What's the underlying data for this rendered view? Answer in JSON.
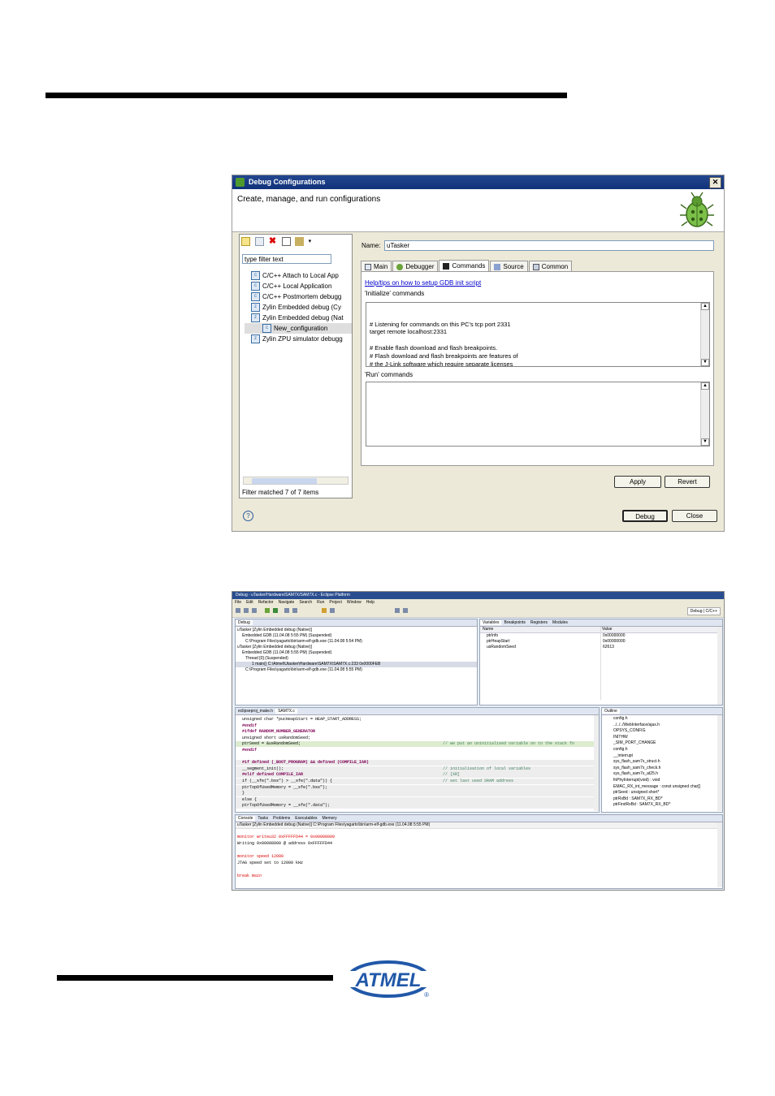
{
  "dialog": {
    "title": "Debug Configurations",
    "header": "Create, manage, and run configurations",
    "filter_placeholder": "type filter text",
    "tree": [
      {
        "label": "C/C++ Attach to Local App",
        "icon": "c-app-icon",
        "indent": 1
      },
      {
        "label": "C/C++ Local Application",
        "icon": "c-app-icon",
        "indent": 1
      },
      {
        "label": "C/C++ Postmortem debugg",
        "icon": "c-app-icon",
        "indent": 1
      },
      {
        "label": "Zylin Embedded debug (Cy",
        "icon": "zylin-icon",
        "indent": 1
      },
      {
        "label": "Zylin Embedded debug (Nat",
        "icon": "zylin-icon",
        "indent": 1
      },
      {
        "label": "New_configuration",
        "icon": "config-icon",
        "indent": 2,
        "selected": true
      },
      {
        "label": "Zylin ZPU simulator debugg",
        "icon": "zylin-icon",
        "indent": 1
      }
    ],
    "filter_status": "Filter matched 7 of 7 items",
    "name_label": "Name:",
    "name_value": "uTasker",
    "tabs": [
      "Main",
      "Debugger",
      "Commands",
      "Source",
      "Common"
    ],
    "active_tab": "Commands",
    "help_link": "Help/tips on how to setup GDB init script",
    "init_label": "'Initialize' commands",
    "init_commands": "# Listening for commands on this PC's tcp port 2331\ntarget remote localhost:2331\n\n# Enable flash download and flash breakpoints.\n# Flash download and flash breakpoints are features of\n# the J-Link software which require separate licenses\n# from SEGGER.",
    "run_label": "'Run' commands",
    "apply_label": "Apply",
    "revert_label": "Revert",
    "debug_label": "Debug",
    "close_label": "Close"
  },
  "eclipse": {
    "title": "Debug - uTasker/Hardware/SAM7X/SAM7X.c - Eclipse Platform",
    "menu": [
      "File",
      "Edit",
      "Refactor",
      "Navigate",
      "Search",
      "Run",
      "Project",
      "Window",
      "Help"
    ],
    "perspectives": [
      "Debug",
      "C/C++"
    ],
    "debug_view_tab": "Debug",
    "debug_tree": [
      "uTasker [Zylin Embedded debug (Native)]",
      "Embedded GDB (11.04.08 5:55 PM) (Suspended)",
      "C:\\Program Files\\yagarto\\bin\\arm-elf-gdb.exe (11.04.08 5:54 PM)",
      "uTasker [Zylin Embedded debug (Native)]",
      "Embedded GDB (11.04.08 5:55 PM) (Suspended)",
      "Thread [0] (Suspended)",
      "1 main() C:\\Atmel\\Utasker\\Hardware\\SAM7X\\SAM7X.c:233 0x0000FEB",
      "C:\\Program Files\\yagarto\\bin\\arm-elf-gdb.exe (11.04.08 5:55 PM)"
    ],
    "variables_tabs": [
      "Variables",
      "Breakpoints",
      "Registers",
      "Modules"
    ],
    "variables_headers": [
      "Name",
      "Value"
    ],
    "variables": [
      {
        "name": "ptrInfo",
        "value": "0x00000000"
      },
      {
        "name": "ptrHeapStart",
        "value": "0x00000000"
      },
      {
        "name": "usRandomSeed",
        "value": "62613"
      }
    ],
    "editor_tabs": [
      "eclipseproj_make.h",
      "SAM7X.c"
    ],
    "code_lines": [
      {
        "t": "    unsigned char *pucHeapStart = HEAP_START_ADDRESS;",
        "c": ""
      },
      {
        "t": "#endif",
        "c": ""
      },
      {
        "t": "#ifdef RANDOM_NUMBER_GENERATOR",
        "c": ""
      },
      {
        "t": "    unsigned short usRandomSeed;",
        "c": ""
      },
      {
        "t": "    ptrSeed = &usRandomSeed;",
        "c": "// we put an uninitialised variable on to the stack fo"
      },
      {
        "t": "#endif",
        "c": ""
      },
      {
        "t": "",
        "c": ""
      },
      {
        "t": "#if defined (_BOOT_PROGRAM) && defined (COMPILE_IAR)",
        "c": ""
      },
      {
        "t": "    __segment_init();",
        "c": "// initialisation of local variables"
      },
      {
        "t": "#elif defined COMPILE_IAR",
        "c": "// [XR]"
      },
      {
        "t": "    if (__sfe(\".bss\") > __sfe(\".data\")) {",
        "c": "// set last used SRAM address"
      },
      {
        "t": "        ptrTopOfUsedMemory = __sfe(\".bss\");",
        "c": ""
      },
      {
        "t": "    }",
        "c": ""
      },
      {
        "t": "    else {",
        "c": ""
      },
      {
        "t": "        ptrTopOfUsedMemory = __sfe(\".data\");",
        "c": ""
      }
    ],
    "outline_tab": "Outline",
    "outline": [
      "config.h",
      "../../../WebInterface/ajax.h",
      "OPSYS_CONFIG",
      "INITHW",
      "_SIM_PORT_CHANGE",
      "config.h",
      "__interrupt",
      "sys_flash_sam7x_struct.h",
      "sys_flash_sam7x_check.h",
      "sys_flash_sam7x_at25.h",
      "fnPhyInterrupt(void) : void",
      "EMAC_RX_int_message : const unsigned char[]",
      "ptrSeed : unsigned short*",
      "ptrRxBd : SAM7X_RX_BD*",
      "ptrFirstRxBd : SAM7X_RX_BD*"
    ],
    "console_tabs": [
      "Console",
      "Tasks",
      "Problems",
      "Executables",
      "Memory"
    ],
    "console_header": "uTasker [Zylin Embedded debug (Native)] C:\\Program Files\\yagarto\\bin\\arm-elf-gdb.exe (11.04.08 5:55 PM)",
    "console_lines": [
      {
        "t": "monitor writeu32 0xFFFFFD44 = 0x00008000",
        "red": true
      },
      {
        "t": "Writing 0x00008000 @ address 0xFFFFFD44",
        "red": false
      },
      {
        "t": "",
        "red": false
      },
      {
        "t": "monitor speed 12000",
        "red": true
      },
      {
        "t": "JTAG speed set to 12000 kHz",
        "red": false
      },
      {
        "t": "",
        "red": false
      },
      {
        "t": "break main",
        "red": true
      }
    ]
  },
  "logo": {
    "text": "ATMEL",
    "registered": "®",
    "color": "#2158a8"
  }
}
